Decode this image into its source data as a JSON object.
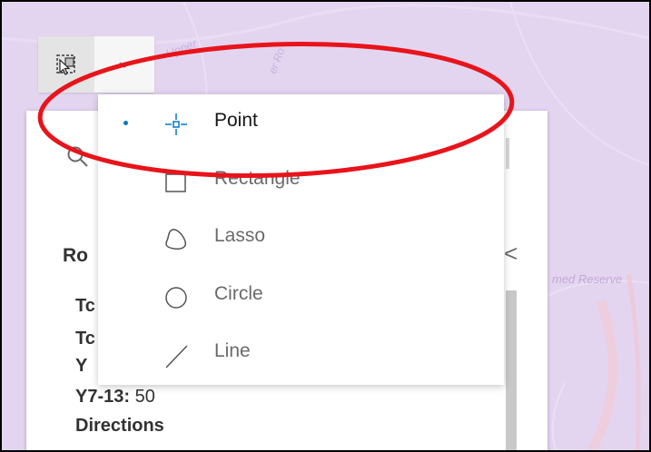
{
  "map": {
    "labels": [
      "Upper",
      "er Ro",
      "med Reserve"
    ]
  },
  "toolbar": {
    "select_icon": "select-by-shape-icon",
    "dropdown_icon": "chevron-down-icon"
  },
  "panel": {
    "search_icon": "search-icon",
    "title": "Ro",
    "collapse_glyph": "<",
    "lines": [
      {
        "bold": "Tc",
        "text": ""
      },
      {
        "bold": "Tc",
        "text": ""
      },
      {
        "bold": "Y",
        "text": ""
      },
      {
        "bold": "Y7-13:",
        "text": " 50"
      },
      {
        "bold": "Directions",
        "text": ""
      }
    ]
  },
  "menu": {
    "items": [
      {
        "label": "Point",
        "icon": "point-crosshair-icon",
        "selected": true
      },
      {
        "label": "Rectangle",
        "icon": "rectangle-icon",
        "selected": false
      },
      {
        "label": "Lasso",
        "icon": "lasso-icon",
        "selected": false
      },
      {
        "label": "Circle",
        "icon": "circle-icon",
        "selected": false
      },
      {
        "label": "Line",
        "icon": "line-icon",
        "selected": false
      }
    ]
  },
  "colors": {
    "map_background": "#e3d5f0",
    "accent": "#007ac2",
    "annotation": "#e8141b"
  }
}
